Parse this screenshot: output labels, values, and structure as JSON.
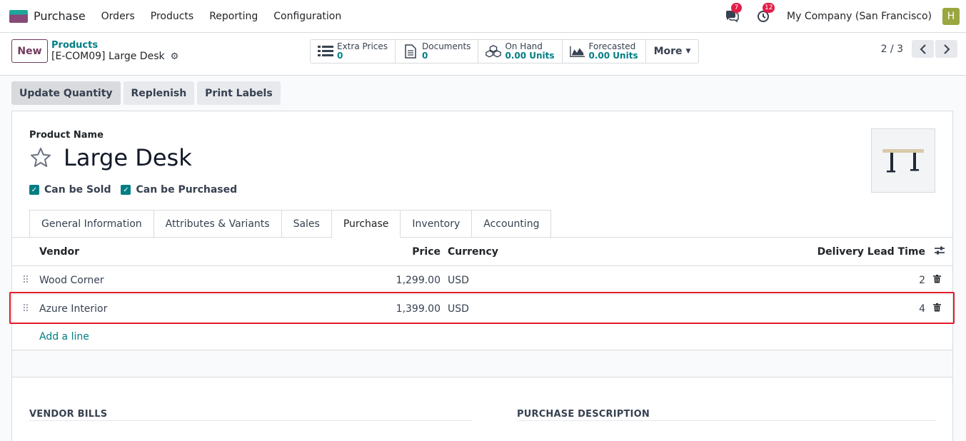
{
  "navbar": {
    "app_name": "Purchase",
    "menu": [
      "Orders",
      "Products",
      "Reporting",
      "Configuration"
    ],
    "messages_badge": "7",
    "activities_badge": "12",
    "company": "My Company (San Francisco)",
    "avatar_letter": "H"
  },
  "control_panel": {
    "new_label": "New",
    "breadcrumb_parent": "Products",
    "breadcrumb_current": "[E-COM09] Large Desk",
    "smart_buttons": [
      {
        "label": "Extra Prices",
        "value": "0",
        "icon": "list-icon"
      },
      {
        "label": "Documents",
        "value": "0",
        "icon": "document-icon"
      },
      {
        "label": "On Hand",
        "value": "0.00 Units",
        "icon": "cubes-icon"
      },
      {
        "label": "Forecasted",
        "value": "0.00 Units",
        "icon": "area-chart-icon"
      }
    ],
    "more_label": "More",
    "pager": "2 / 3"
  },
  "actions": {
    "update_quantity": "Update Quantity",
    "replenish": "Replenish",
    "print_labels": "Print Labels"
  },
  "form": {
    "product_name_label": "Product Name",
    "product_name": "Large Desk",
    "can_be_sold": "Can be Sold",
    "can_be_purchased": "Can be Purchased",
    "tabs": [
      "General Information",
      "Attributes & Variants",
      "Sales",
      "Purchase",
      "Inventory",
      "Accounting"
    ],
    "active_tab": "Purchase",
    "table": {
      "headers": {
        "vendor": "Vendor",
        "price": "Price",
        "currency": "Currency",
        "lead_time": "Delivery Lead Time"
      },
      "rows": [
        {
          "vendor": "Wood Corner",
          "price": "1,299.00",
          "currency": "USD",
          "lead_time": "2"
        },
        {
          "vendor": "Azure Interior",
          "price": "1,399.00",
          "currency": "USD",
          "lead_time": "4"
        }
      ],
      "add_line": "Add a line"
    },
    "vendor_bills_title": "VENDOR BILLS",
    "purchase_description_title": "PURCHASE DESCRIPTION"
  },
  "colors": {
    "brand": "#71395f",
    "accent": "#017e84",
    "highlight": "#e11d2a"
  }
}
